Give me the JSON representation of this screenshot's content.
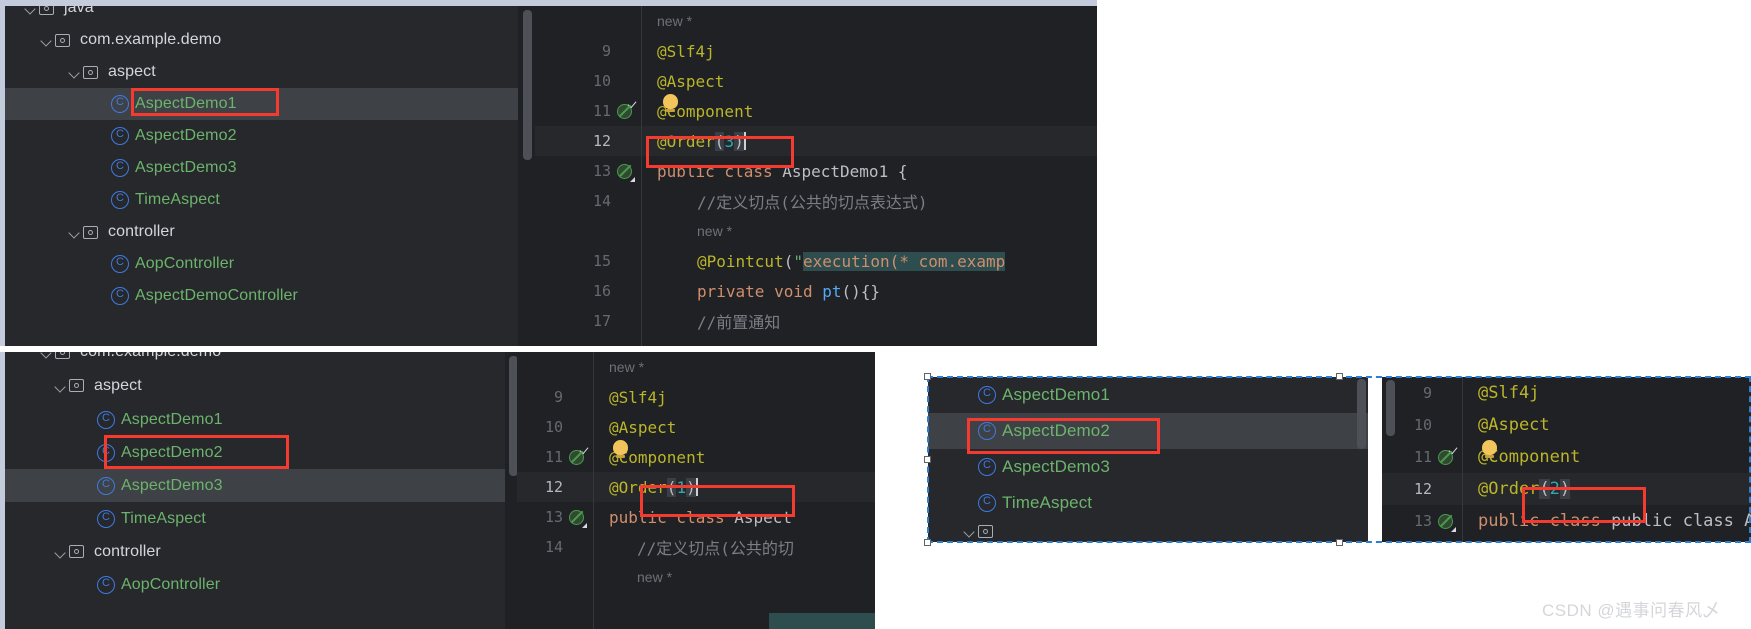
{
  "meta": {
    "watermark": "CSDN @遇事问春风乄"
  },
  "top_panel": {
    "tree": {
      "rows": [
        {
          "icon": "folder-icon",
          "label": "java",
          "kind": "pkg",
          "indent": 0,
          "chevron": true,
          "selected": false,
          "clipped": true
        },
        {
          "icon": "folder-icon",
          "label": "com.example.demo",
          "kind": "pkg",
          "indent": 1,
          "chevron": true,
          "selected": false
        },
        {
          "icon": "folder-icon",
          "label": "aspect",
          "kind": "pkg",
          "indent": 2,
          "chevron": true,
          "selected": false
        },
        {
          "icon": "class-icon",
          "label": "AspectDemo1",
          "kind": "cls",
          "indent": 3,
          "chevron": false,
          "selected": true
        },
        {
          "icon": "class-icon",
          "label": "AspectDemo2",
          "kind": "cls",
          "indent": 3,
          "chevron": false,
          "selected": false
        },
        {
          "icon": "class-icon",
          "label": "AspectDemo3",
          "kind": "cls",
          "indent": 3,
          "chevron": false,
          "selected": false
        },
        {
          "icon": "class-icon",
          "label": "TimeAspect",
          "kind": "cls",
          "indent": 3,
          "chevron": false,
          "selected": false
        },
        {
          "icon": "folder-icon",
          "label": "controller",
          "kind": "pkg",
          "indent": 2,
          "chevron": true,
          "selected": false
        },
        {
          "icon": "class-icon",
          "label": "AopController",
          "kind": "cls",
          "indent": 3,
          "chevron": false,
          "selected": false
        },
        {
          "icon": "class-icon",
          "label": "AspectDemoController",
          "kind": "cls",
          "indent": 3,
          "chevron": false,
          "selected": false
        }
      ]
    },
    "editor": {
      "inline_hint_top": "new *",
      "lines": [
        {
          "num": "9",
          "marker": "none",
          "text": "@Slf4j",
          "current": false
        },
        {
          "num": "10",
          "marker": "none",
          "text": "@Aspect",
          "current": false
        },
        {
          "num": "11",
          "marker": "run-check",
          "text": "@Component",
          "current": false,
          "bulb": true
        },
        {
          "num": "12",
          "marker": "none",
          "text": "@Order(3)",
          "current": true,
          "caret": true
        },
        {
          "num": "13",
          "marker": "run-corner",
          "text": "public class AspectDemo1 {",
          "current": false
        },
        {
          "num": "14",
          "marker": "none",
          "text": "//定义切点(公共的切点表达式)",
          "current": false
        },
        {
          "num": "",
          "marker": "none",
          "text": "new *",
          "current": false,
          "hint": true
        },
        {
          "num": "15",
          "marker": "none",
          "text": "@Pointcut(\"execution(* com.examp",
          "current": false
        },
        {
          "num": "16",
          "marker": "none",
          "text": "private void pt(){}",
          "current": false
        },
        {
          "num": "17",
          "marker": "none",
          "text": "//前置通知",
          "current": false
        }
      ],
      "order_value": "3",
      "class_name": "AspectDemo1"
    }
  },
  "bottom_left_panel": {
    "tree": {
      "rows": [
        {
          "icon": "folder-icon",
          "label": "com.example.demo",
          "kind": "pkg",
          "indent": 1,
          "chevron": true,
          "selected": false,
          "clipped": true
        },
        {
          "icon": "folder-icon",
          "label": "aspect",
          "kind": "pkg",
          "indent": 2,
          "chevron": true,
          "selected": false
        },
        {
          "icon": "class-icon",
          "label": "AspectDemo1",
          "kind": "cls",
          "indent": 3,
          "chevron": false,
          "selected": false
        },
        {
          "icon": "class-icon",
          "label": "AspectDemo2",
          "kind": "cls",
          "indent": 3,
          "chevron": false,
          "selected": false
        },
        {
          "icon": "class-icon",
          "label": "AspectDemo3",
          "kind": "cls",
          "indent": 3,
          "chevron": false,
          "selected": true
        },
        {
          "icon": "class-icon",
          "label": "TimeAspect",
          "kind": "cls",
          "indent": 3,
          "chevron": false,
          "selected": false
        },
        {
          "icon": "folder-icon",
          "label": "controller",
          "kind": "pkg",
          "indent": 2,
          "chevron": true,
          "selected": false
        },
        {
          "icon": "class-icon",
          "label": "AopController",
          "kind": "cls",
          "indent": 3,
          "chevron": false,
          "selected": false
        }
      ]
    },
    "editor": {
      "inline_hint_top": "new *",
      "lines": [
        {
          "num": "9",
          "marker": "none",
          "text": "@Slf4j",
          "current": false
        },
        {
          "num": "10",
          "marker": "none",
          "text": "@Aspect",
          "current": false
        },
        {
          "num": "11",
          "marker": "run-check",
          "text": "@Component",
          "current": false,
          "bulb": true
        },
        {
          "num": "12",
          "marker": "none",
          "text": "@Order(1)",
          "current": true,
          "caret": true
        },
        {
          "num": "13",
          "marker": "run-corner",
          "text": "public class Aspect",
          "current": false
        },
        {
          "num": "14",
          "marker": "none",
          "text": "//定义切点(公共的切",
          "current": false
        },
        {
          "num": "",
          "marker": "none",
          "text": "new *",
          "current": false,
          "hint": true
        }
      ],
      "order_value": "1",
      "class_name": "Aspect"
    }
  },
  "bottom_right_tree_panel": {
    "rows": [
      {
        "icon": "class-icon",
        "label": "AspectDemo1",
        "kind": "cls",
        "indent": 3,
        "chevron": false,
        "selected": false
      },
      {
        "icon": "class-icon",
        "label": "AspectDemo2",
        "kind": "cls",
        "indent": 3,
        "chevron": false,
        "selected": true
      },
      {
        "icon": "class-icon",
        "label": "AspectDemo3",
        "kind": "cls",
        "indent": 3,
        "chevron": false,
        "selected": false
      },
      {
        "icon": "class-icon",
        "label": "TimeAspect",
        "kind": "cls",
        "indent": 3,
        "chevron": false,
        "selected": false
      },
      {
        "icon": "folder-icon",
        "label": "",
        "kind": "pkg",
        "indent": 2,
        "chevron": true,
        "selected": false,
        "clipped": true
      }
    ]
  },
  "bottom_right_editor_panel": {
    "lines": [
      {
        "num": "9",
        "marker": "none",
        "text": "@Slf4j",
        "current": false
      },
      {
        "num": "10",
        "marker": "none",
        "text": "@Aspect",
        "current": false
      },
      {
        "num": "11",
        "marker": "run-check",
        "text": "@Component",
        "current": false,
        "bulb": true
      },
      {
        "num": "12",
        "marker": "none",
        "text": "@Order(2)",
        "current": true
      },
      {
        "num": "13",
        "marker": "run-corner",
        "text": "public class Asp",
        "current": false
      }
    ],
    "order_value": "2"
  },
  "colors": {
    "annotation_box": "#f53b2f",
    "selection_marquee": "#2a7fd4",
    "tree_bg": "#26282c",
    "editor_bg": "#1f2124",
    "class_name_green": "#6cb36c",
    "annotation_yellow": "#bbb529",
    "number_cyan": "#2aacb8"
  }
}
